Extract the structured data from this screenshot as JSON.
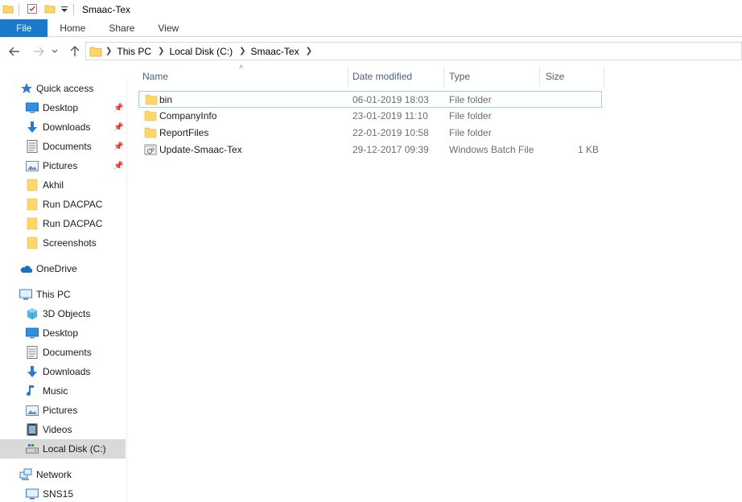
{
  "window": {
    "title": "Smaac-Tex"
  },
  "quick_access_toolbar": {
    "icons": [
      "folder-icon",
      "properties-icon",
      "new-folder-icon",
      "customize-dropdown-icon"
    ]
  },
  "ribbon": {
    "tabs": [
      "File",
      "Home",
      "Share",
      "View"
    ]
  },
  "address_bar": {
    "icons": [
      "back-arrow-icon",
      "forward-arrow-icon",
      "recent-dropdown-icon",
      "up-arrow-icon"
    ],
    "breadcrumbs": [
      "This PC",
      "Local Disk (C:)",
      "Smaac-Tex"
    ]
  },
  "sidebar": {
    "quick_access": "Quick access",
    "quick_items": [
      {
        "label": "Desktop",
        "icon": "desktop-icon",
        "pinned": true
      },
      {
        "label": "Downloads",
        "icon": "downloads-icon",
        "pinned": true
      },
      {
        "label": "Documents",
        "icon": "documents-icon",
        "pinned": true
      },
      {
        "label": "Pictures",
        "icon": "pictures-icon",
        "pinned": true
      },
      {
        "label": "Akhil",
        "icon": "folder-icon",
        "pinned": false
      },
      {
        "label": "Run DACPAC",
        "icon": "folder-icon",
        "pinned": false
      },
      {
        "label": "Run DACPAC",
        "icon": "folder-icon",
        "pinned": false
      },
      {
        "label": "Screenshots",
        "icon": "folder-icon",
        "pinned": false
      }
    ],
    "onedrive": "OneDrive",
    "this_pc": "This PC",
    "pc_items": [
      {
        "label": "3D Objects",
        "icon": "3d-objects-icon"
      },
      {
        "label": "Desktop",
        "icon": "desktop-icon"
      },
      {
        "label": "Documents",
        "icon": "documents-icon"
      },
      {
        "label": "Downloads",
        "icon": "downloads-icon"
      },
      {
        "label": "Music",
        "icon": "music-icon"
      },
      {
        "label": "Pictures",
        "icon": "pictures-icon"
      },
      {
        "label": "Videos",
        "icon": "videos-icon"
      },
      {
        "label": "Local Disk (C:)",
        "icon": "local-disk-icon",
        "selected": true
      }
    ],
    "network": "Network",
    "network_items": [
      {
        "label": "SNS15",
        "icon": "computer-icon"
      }
    ]
  },
  "file_list": {
    "columns": [
      "Name",
      "Date modified",
      "Type",
      "Size"
    ],
    "rows": [
      {
        "name": "bin",
        "date": "06-01-2019 18:03",
        "type": "File folder",
        "size": "",
        "icon": "folder-icon",
        "focused": true
      },
      {
        "name": "CompanyInfo",
        "date": "23-01-2019 11:10",
        "type": "File folder",
        "size": "",
        "icon": "folder-icon"
      },
      {
        "name": "ReportFiles",
        "date": "22-01-2019 10:58",
        "type": "File folder",
        "size": "",
        "icon": "folder-icon"
      },
      {
        "name": "Update-Smaac-Tex",
        "date": "29-12-2017 09:39",
        "type": "Windows Batch File",
        "size": "1 KB",
        "icon": "batch-file-icon"
      }
    ]
  },
  "colors": {
    "file_tab": "#1979ca",
    "selection": "#d9d9d9",
    "focus_border": "#99d1ff",
    "folder": "#ffd766"
  }
}
